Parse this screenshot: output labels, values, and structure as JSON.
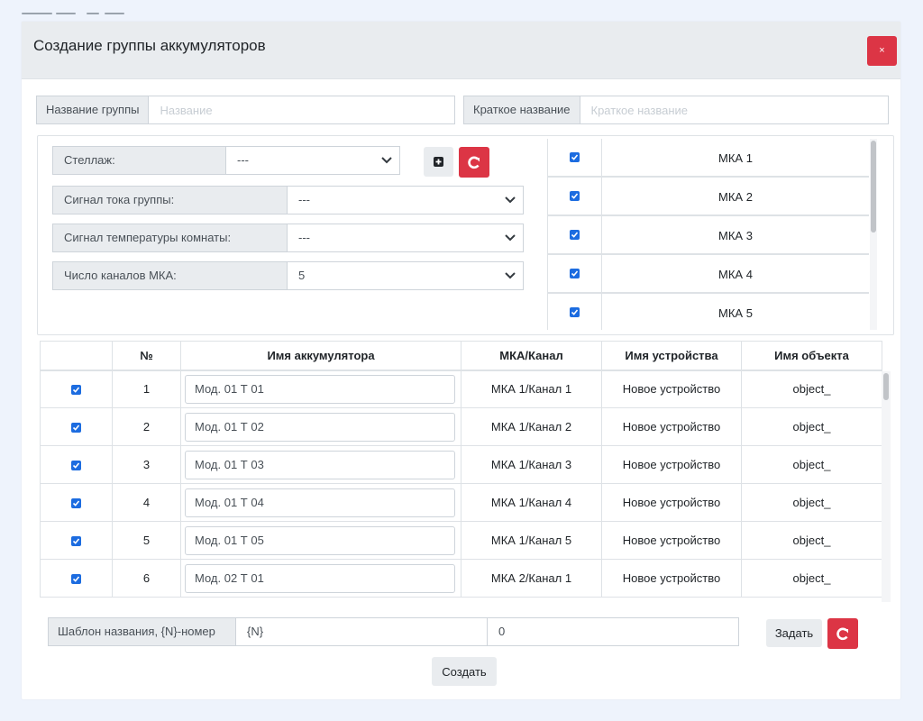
{
  "modal": {
    "title": "Создание группы аккумуляторов",
    "close_label": "×"
  },
  "group_name": {
    "label": "Название группы",
    "placeholder": "Название",
    "value": ""
  },
  "short_name": {
    "label": "Краткое название",
    "placeholder": "Краткое название",
    "value": ""
  },
  "rack": {
    "label": "Стеллаж:",
    "value": "---"
  },
  "current_signal": {
    "label": "Сигнал тока группы:",
    "value": "---"
  },
  "temp_signal": {
    "label": "Сигнал температуры комнаты:",
    "value": "---"
  },
  "mka_channels": {
    "label": "Число каналов МКА:",
    "value": "5"
  },
  "mka_list": [
    {
      "label": "МКА 1",
      "checked": true
    },
    {
      "label": "МКА 2",
      "checked": true
    },
    {
      "label": "МКА 3",
      "checked": true
    },
    {
      "label": "МКА 4",
      "checked": true
    },
    {
      "label": "МКА 5",
      "checked": true
    }
  ],
  "table": {
    "headers": [
      "",
      "№",
      "Имя аккумулятора",
      "МКА/Канал",
      "Имя устройства",
      "Имя объекта"
    ],
    "rows": [
      {
        "num": "1",
        "name": "Мод. 01 Т 01",
        "channel": "МКА 1/Канал 1",
        "device": "Новое устройство",
        "object": "object_"
      },
      {
        "num": "2",
        "name": "Мод. 01 Т 02",
        "channel": "МКА 1/Канал 2",
        "device": "Новое устройство",
        "object": "object_"
      },
      {
        "num": "3",
        "name": "Мод. 01 Т 03",
        "channel": "МКА 1/Канал 3",
        "device": "Новое устройство",
        "object": "object_"
      },
      {
        "num": "4",
        "name": "Мод. 01 Т 04",
        "channel": "МКА 1/Канал 4",
        "device": "Новое устройство",
        "object": "object_"
      },
      {
        "num": "5",
        "name": "Мод. 01 Т 05",
        "channel": "МКА 1/Канал 5",
        "device": "Новое устройство",
        "object": "object_"
      },
      {
        "num": "6",
        "name": "Мод. 02 Т 01",
        "channel": "МКА 2/Канал 1",
        "device": "Новое устройство",
        "object": "object_"
      }
    ]
  },
  "template": {
    "label": "Шаблон названия, {N}-номер",
    "pattern_value": "{N}",
    "start_value": "0",
    "apply_label": "Задать"
  },
  "create_label": "Создать",
  "colors": {
    "accent_red": "#dc3545",
    "checkbox_blue": "#1c6ce0",
    "header_gray": "#e9ecef"
  }
}
